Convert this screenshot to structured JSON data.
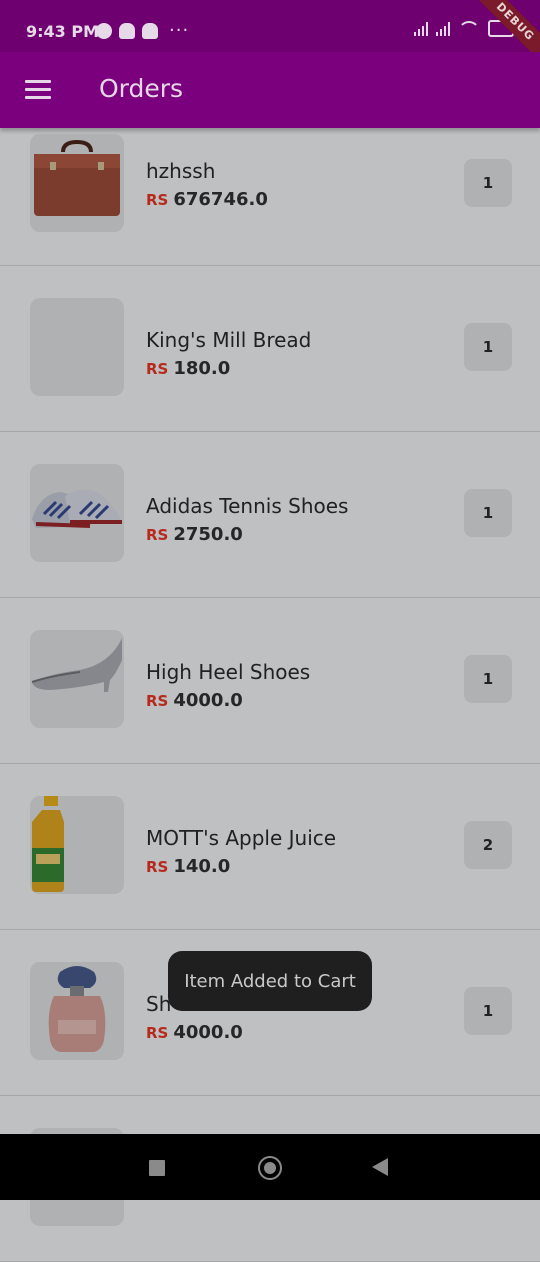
{
  "status": {
    "time": "9:43 PM",
    "dots": "···",
    "debug_label": "DEBUG"
  },
  "appbar": {
    "title": "Orders",
    "menu_icon": "hamburger-menu-icon"
  },
  "orders": [
    {
      "name": "hzhssh",
      "currency": "RS",
      "price": "676746.0",
      "qty": "1",
      "image": "brown-briefcase"
    },
    {
      "name": "King's Mill Bread",
      "currency": "RS",
      "price": "180.0",
      "qty": "1",
      "image": "empty"
    },
    {
      "name": "Adidas Tennis Shoes",
      "currency": "RS",
      "price": "2750.0",
      "qty": "1",
      "image": "sneakers"
    },
    {
      "name": "High Heel Shoes",
      "currency": "RS",
      "price": "4000.0",
      "qty": "1",
      "image": "silver-heel"
    },
    {
      "name": "MOTT's  Apple Juice",
      "currency": "RS",
      "price": "140.0",
      "qty": "2",
      "image": "juice-bottle"
    },
    {
      "name": "Sh",
      "currency": "RS",
      "price": "4000.0",
      "qty": "1",
      "image": "perfume-bottle"
    }
  ],
  "toast": {
    "text": "Item Added to Cart"
  },
  "colors": {
    "appbar": "#7b007d",
    "statusbar": "#6e006f",
    "currency": "#b52a1d",
    "background": "#bfc0c2"
  }
}
